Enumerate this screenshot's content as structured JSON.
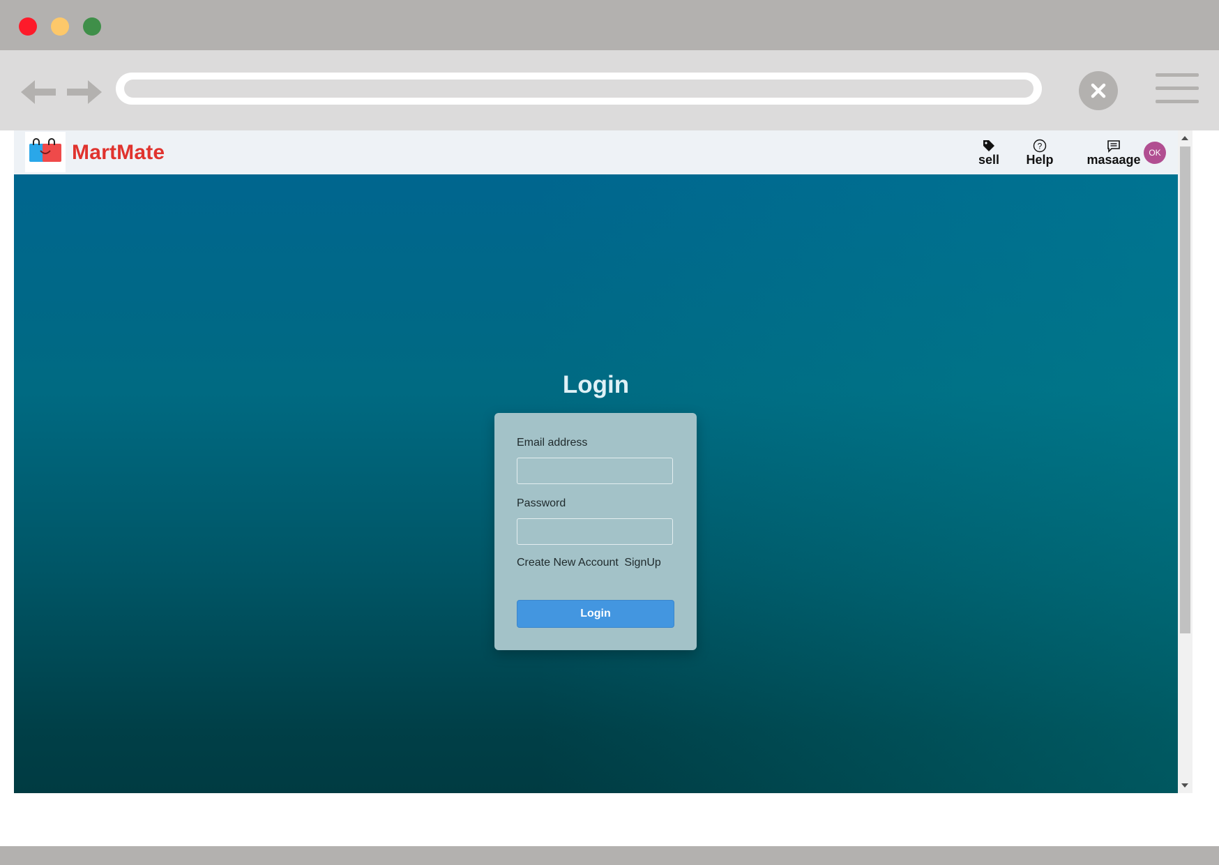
{
  "browser": {
    "window_controls": [
      "close",
      "minimize",
      "maximize"
    ],
    "icons": {
      "back": "arrow-left-icon",
      "forward": "arrow-right-icon",
      "stop": "close-icon",
      "menu": "hamburger-menu-icon"
    },
    "url": ""
  },
  "site": {
    "brand": "MartMate",
    "brand_color": "#e0332e",
    "nav": {
      "sell_label": "sell",
      "help_label": "Help",
      "message_label": "masaage",
      "avatar_initials": "OK"
    },
    "icons": {
      "logo": "shopping-bags-logo-icon",
      "sell": "tag-icon",
      "help": "question-circle-icon",
      "message": "chat-bubble-icon"
    }
  },
  "login": {
    "title": "Login",
    "email_label": "Email address",
    "email_value": "",
    "password_label": "Password",
    "password_value": "",
    "create_account_text": "Create New Account",
    "signup_link": "SignUp",
    "submit_label": "Login",
    "button_color": "#4396e0"
  },
  "colors": {
    "hero_top": "#00668f",
    "hero_bottom": "#003b42",
    "card_background": "#a3c2c8",
    "avatar_background": "#b14e91"
  }
}
